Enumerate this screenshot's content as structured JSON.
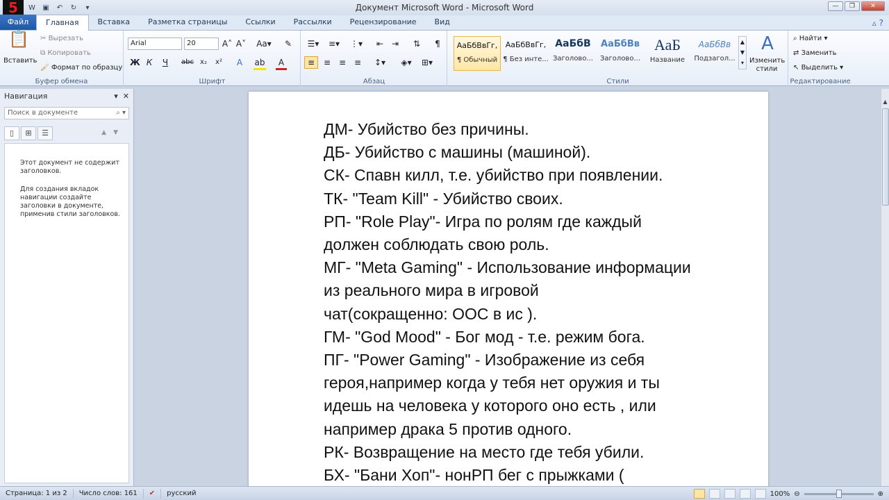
{
  "title_bar": {
    "title": "Документ Microsoft Word  -  Microsoft Word",
    "logo_text": "5"
  },
  "tabs": [
    "Файл",
    "Главная",
    "Вставка",
    "Разметка страницы",
    "Ссылки",
    "Рассылки",
    "Рецензирование",
    "Вид"
  ],
  "ribbon": {
    "clipboard": {
      "paste": "Вставить",
      "cut": "Вырезать",
      "copy": "Копировать",
      "format_painter": "Формат по образцу",
      "label": "Буфер обмена"
    },
    "font": {
      "family": "Arial",
      "size": "20",
      "label": "Шрифт"
    },
    "paragraph": {
      "label": "Абзац"
    },
    "styles": {
      "items": [
        {
          "preview": "АаБбВвГг,",
          "name": "¶ Обычный"
        },
        {
          "preview": "АаБбВвГг,",
          "name": "¶ Без инте..."
        },
        {
          "preview": "АаБбВ",
          "name": "Заголово..."
        },
        {
          "preview": "АаБбВв",
          "name": "Заголово..."
        },
        {
          "preview": "АаБ",
          "name": "Название"
        },
        {
          "preview": "АаБбВв",
          "name": "Подзагол..."
        }
      ],
      "change": "Изменить стили",
      "label": "Стили"
    },
    "editing": {
      "find": "Найти",
      "replace": "Заменить",
      "select": "Выделить",
      "label": "Редактирование"
    }
  },
  "navigation": {
    "title": "Навигация",
    "search_placeholder": "Поиск в документе",
    "msg1": "Этот документ не содержит заголовков.",
    "msg2": "Для создания вкладок навигации создайте заголовки в документе, применив стили заголовков."
  },
  "document": {
    "lines": [
      "ДМ- Убийство без причины.",
      "ДБ- Убийство с машины (машиной).",
      "СК- Спавн килл, т.е. убийство при появлении.",
      "ТК- \"Team Kill\" - Убийство своих.",
      "РП- \"Role Play\"- Игра по ролям где каждый",
      "должен соблюдать свою роль.",
      "МГ- \"Meta Gaming\" - Использование информации",
      "из реального мира в игровой",
      "чат(сокращенно: ООС в ис ).",
      "ГМ- \"God Mood\" - Бог мод - т.е. режим бога.",
      "ПГ- \"Power Gaming\" - Изображение из себя",
      "героя,например когда у тебя нет оружия и ты",
      "идешь на человека у которого оно есть , или",
      "например драка 5 против одного.",
      "РК- Возвращение на место где тебя убили.",
      "БХ- \"Бани Хоп\"- нонРП бег с прыжками ("
    ]
  },
  "status": {
    "page": "Страница: 1 из 2",
    "words": "Число слов: 161",
    "lang": "русский",
    "zoom": "100%"
  }
}
